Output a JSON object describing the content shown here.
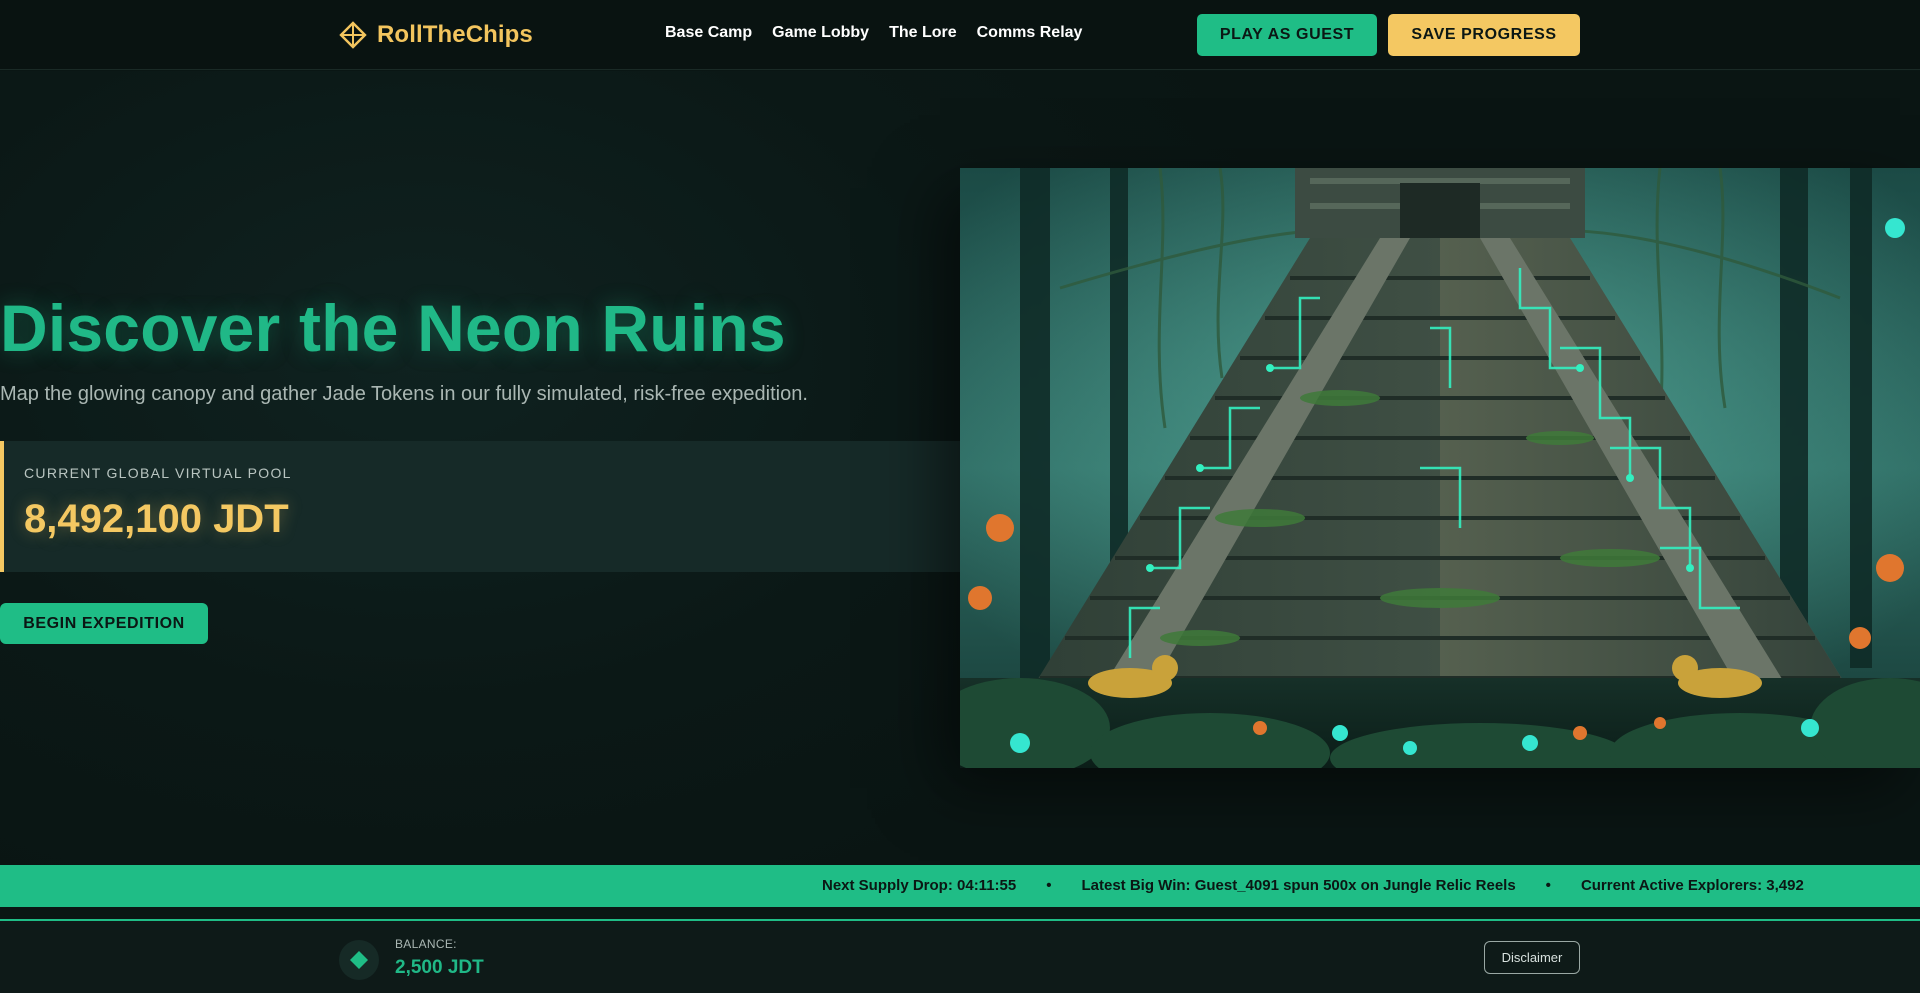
{
  "brand": {
    "name": "RollTheChips",
    "icon": "diamond-compass-icon",
    "color": "#f3c55e"
  },
  "nav": {
    "items": [
      {
        "label": "Base Camp"
      },
      {
        "label": "Game Lobby"
      },
      {
        "label": "The Lore"
      },
      {
        "label": "Comms Relay"
      }
    ]
  },
  "header_actions": {
    "guest_label": "PLAY AS GUEST",
    "save_label": "SAVE PROGRESS"
  },
  "hero": {
    "title": "Discover the Neon Ruins",
    "subtitle": "Map the glowing canopy and gather Jade Tokens in our fully simulated, risk-free expedition.",
    "pool_label": "CURRENT GLOBAL VIRTUAL POOL",
    "pool_value": "8,492,100 JDT",
    "cta_label": "BEGIN EXPEDITION",
    "image_subject": "neon-jungle-pyramid-illustration"
  },
  "ticker": {
    "items": [
      "Next Supply Drop: 04:11:55",
      "Latest Big Win: Guest_4091 spun 500x on Jungle Relic Reels",
      "Current Active Explorers: 3,492"
    ],
    "separator": "•"
  },
  "footer": {
    "balance_label": "BALANCE:",
    "balance_value": "2,500 JDT",
    "wallet_icon": "jade-diamond-icon",
    "disclaimer_label": "Disclaimer"
  },
  "colors": {
    "accent_green": "#1fbd86",
    "accent_gold": "#f4c862",
    "background": "#0a1614"
  }
}
